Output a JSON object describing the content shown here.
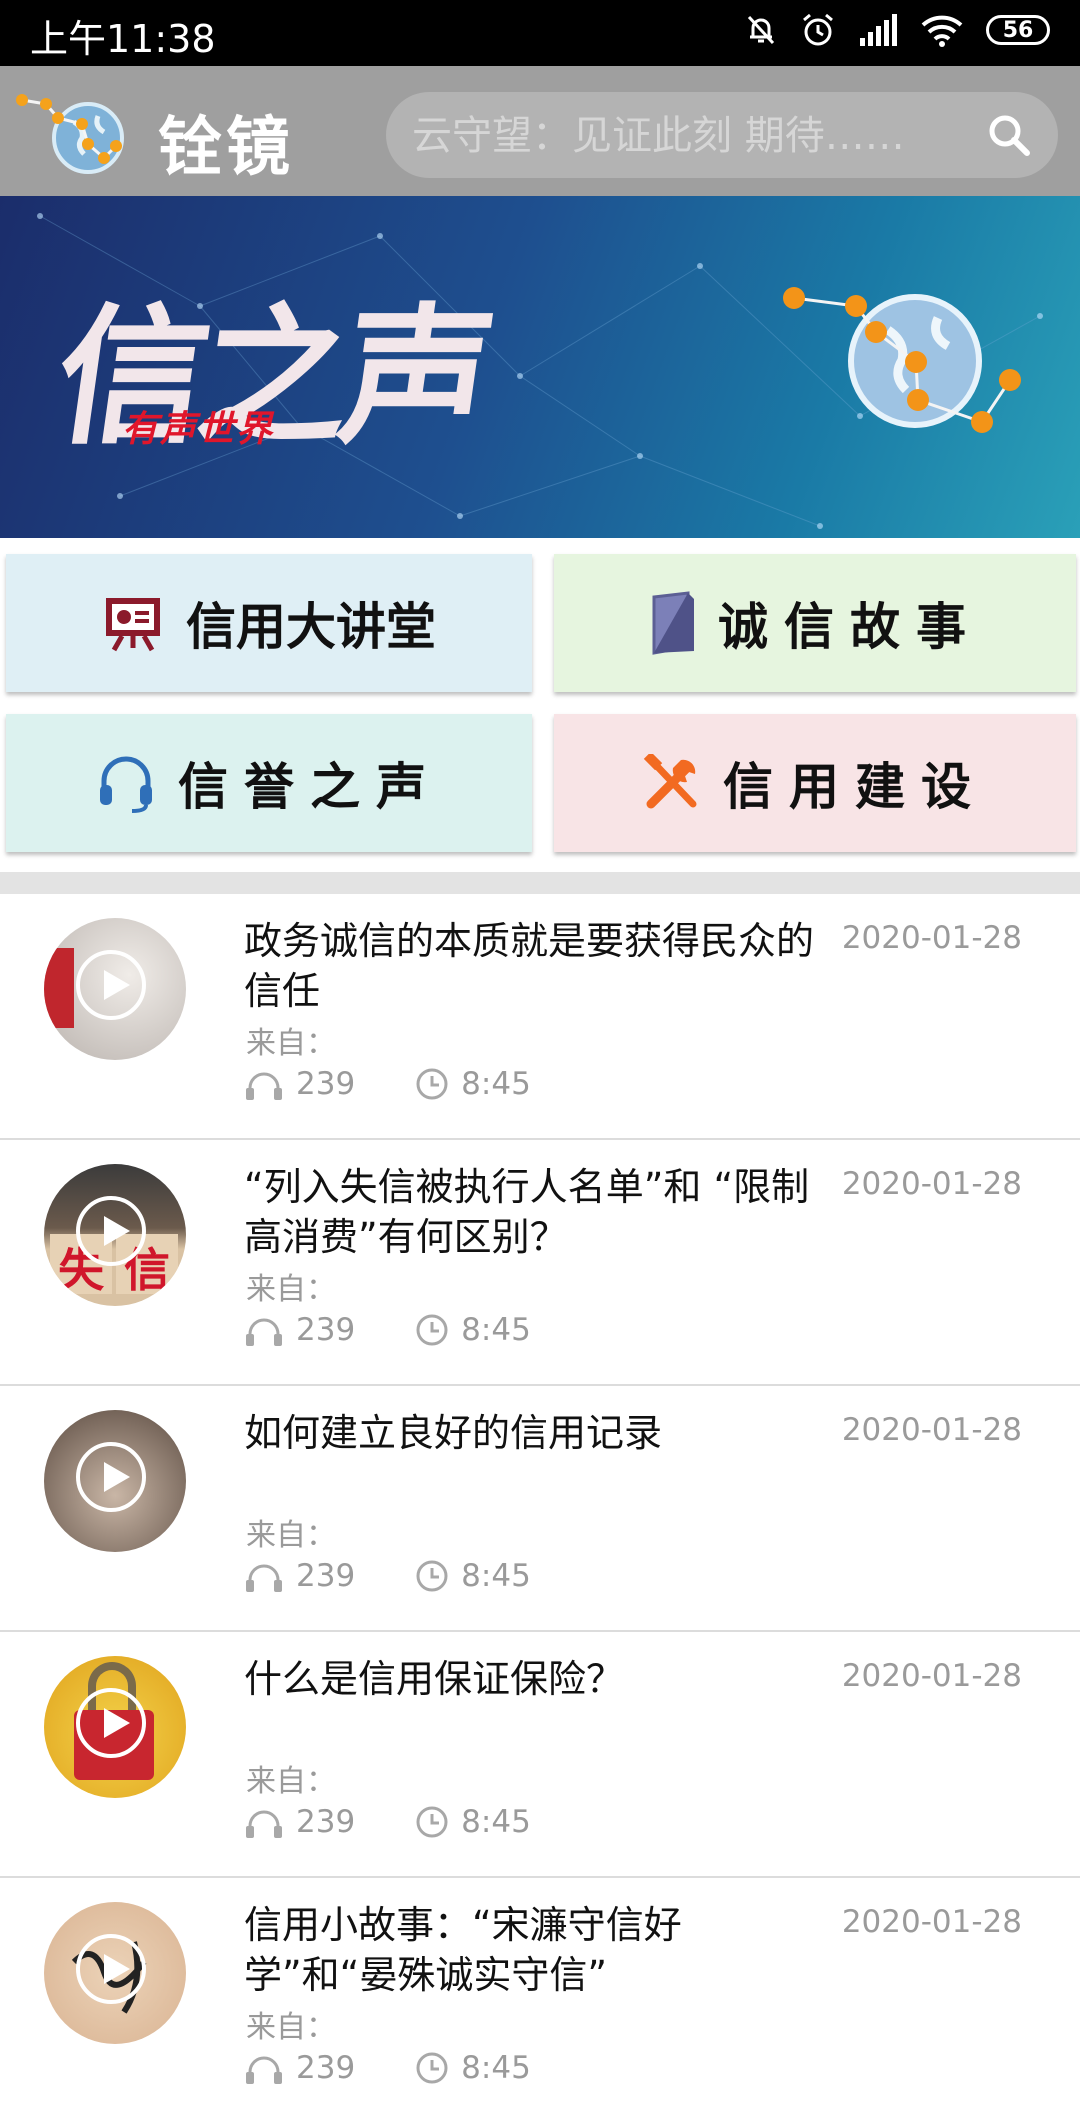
{
  "status_bar": {
    "time": "上午11:38",
    "battery": "56"
  },
  "header": {
    "app_title": "铨镜",
    "search_placeholder": "云守望：见证此刻 期待……"
  },
  "banner": {
    "title": "信之声",
    "subtitle": "有声世界"
  },
  "categories": [
    {
      "label": "信用大讲堂",
      "icon": "presentation-board-icon",
      "bg": "#dfeff5"
    },
    {
      "label": "诚信故事",
      "icon": "book-icon",
      "bg": "#e6f5df"
    },
    {
      "label": "信誉之声",
      "icon": "headset-icon",
      "bg": "#dcf2ef"
    },
    {
      "label": "信用建设",
      "icon": "tools-icon",
      "bg": "#f8e4e6"
    }
  ],
  "list": [
    {
      "title": "政务诚信的本质就是要获得民众的信任",
      "date": "2020-01-28",
      "from": "来自：",
      "plays": "239",
      "duration": "8:45"
    },
    {
      "title": "“列入失信被执行人名单”和 “限制高消费”有何区别？",
      "date": "2020-01-28",
      "from": "来自：",
      "plays": "239",
      "duration": "8:45"
    },
    {
      "title": "如何建立良好的信用记录",
      "date": "2020-01-28",
      "from": "来自：",
      "plays": "239",
      "duration": "8:45"
    },
    {
      "title": "什么是信用保证保险？",
      "date": "2020-01-28",
      "from": "来自：",
      "plays": "239",
      "duration": "8:45"
    },
    {
      "title": "信用小故事：“宋濂守信好学”和“晏殊诚实守信”",
      "date": "2020-01-28",
      "from": "来自：",
      "plays": "239",
      "duration": "8:45"
    }
  ]
}
